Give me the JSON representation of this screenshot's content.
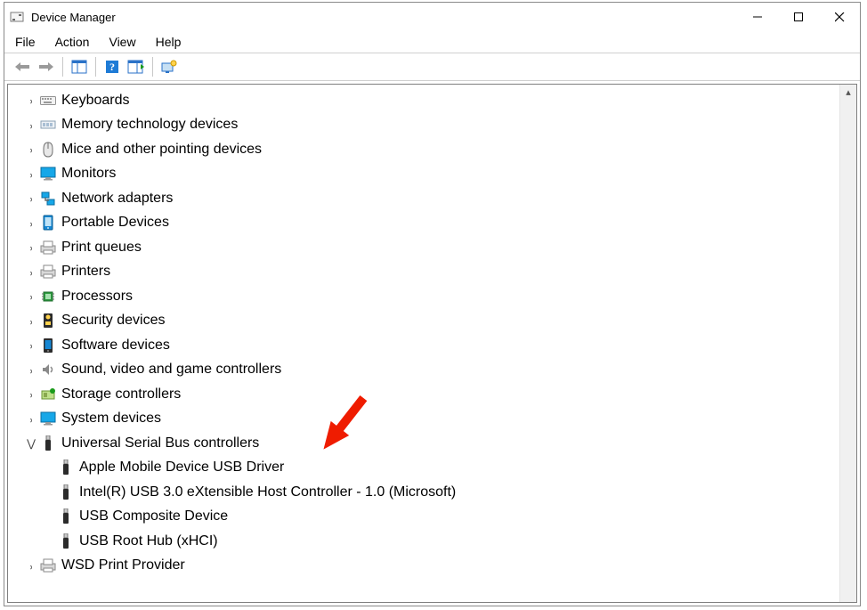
{
  "window": {
    "title": "Device Manager"
  },
  "menu": {
    "items": [
      "File",
      "Action",
      "View",
      "Help"
    ]
  },
  "toolbar": {
    "buttons": [
      "back",
      "forward",
      "properties-pane",
      "help",
      "scan-hardware",
      "devices-view"
    ]
  },
  "tree": {
    "categories": [
      {
        "label": "Keyboards",
        "icon": "keyboard",
        "expanded": false
      },
      {
        "label": "Memory technology devices",
        "icon": "memory",
        "expanded": false
      },
      {
        "label": "Mice and other pointing devices",
        "icon": "mouse",
        "expanded": false
      },
      {
        "label": "Monitors",
        "icon": "monitor",
        "expanded": false
      },
      {
        "label": "Network adapters",
        "icon": "network",
        "expanded": false
      },
      {
        "label": "Portable Devices",
        "icon": "portable",
        "expanded": false
      },
      {
        "label": "Print queues",
        "icon": "printqueue",
        "expanded": false
      },
      {
        "label": "Printers",
        "icon": "printer",
        "expanded": false
      },
      {
        "label": "Processors",
        "icon": "cpu",
        "expanded": false
      },
      {
        "label": "Security devices",
        "icon": "security",
        "expanded": false
      },
      {
        "label": "Software devices",
        "icon": "software",
        "expanded": false
      },
      {
        "label": "Sound, video and game controllers",
        "icon": "sound",
        "expanded": false
      },
      {
        "label": "Storage controllers",
        "icon": "storage",
        "expanded": false
      },
      {
        "label": "System devices",
        "icon": "system",
        "expanded": false
      },
      {
        "label": "Universal Serial Bus controllers",
        "icon": "usb",
        "expanded": true,
        "children": [
          {
            "label": "Apple Mobile Device USB Driver",
            "icon": "usb"
          },
          {
            "label": "Intel(R) USB 3.0 eXtensible Host Controller - 1.0 (Microsoft)",
            "icon": "usb"
          },
          {
            "label": "USB Composite Device",
            "icon": "usb"
          },
          {
            "label": "USB Root Hub (xHCI)",
            "icon": "usb"
          }
        ]
      },
      {
        "label": "WSD Print Provider",
        "icon": "printqueue",
        "expanded": false
      }
    ]
  }
}
